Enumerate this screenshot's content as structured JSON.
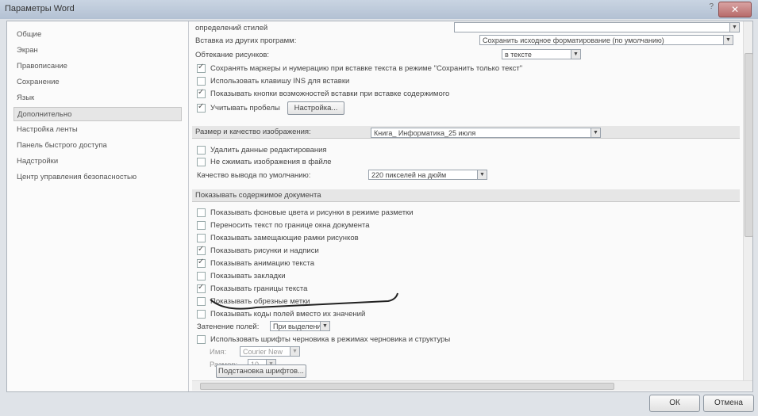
{
  "window": {
    "title": "Параметры Word",
    "close": "✕",
    "help": "? "
  },
  "nav": [
    "Общие",
    "Экран",
    "Правописание",
    "Сохранение",
    "Язык",
    "Дополнительно",
    "Настройка ленты",
    "Панель быстрого доступа",
    "Надстройки",
    "Центр управления безопасностью"
  ],
  "nav_active_index": 5,
  "content": {
    "r0": "определений стилей",
    "r1_label": "Вставка из других программ:",
    "r1_select": "Сохранить исходное форматирование (по умолчанию)",
    "r2_label": "Обтекание рисунков:",
    "r2_select": "в тексте",
    "c1": "Сохранять маркеры и нумерацию при вставке текста в режиме \"Сохранить только текст\"",
    "c2": "Использовать клавишу INS для вставки",
    "c3": "Показывать кнопки возможностей вставки при вставке содержимого",
    "c4": "Учитывать пробелы",
    "c4_btn": "Настройка...",
    "sec_image": "Размер и качество изображения:",
    "sec_image_select": "Книга_ Информатика_25 июля",
    "i1": "Удалить данные редактирования",
    "i2": "Не сжимать изображения в файле",
    "i3_label": "Качество вывода по умолчанию:",
    "i3_select": "220 пикселей на дюйм",
    "sec_show": "Показывать содержимое документа",
    "s1": "Показывать фоновые цвета и рисунки в режиме разметки",
    "s2": "Переносить текст по границе окна документа",
    "s3": "Показывать замещающие рамки рисунков",
    "s4": "Показывать рисунки и надписи",
    "s5": "Показывать анимацию текста",
    "s6": "Показывать закладки",
    "s7": "Показывать границы текста",
    "s8": "Показывать обрезные метки",
    "s9": "Показывать коды полей вместо их значений",
    "f_label": "Затенение полей:",
    "f_select": "При выделении",
    "d1": "Использовать шрифты черновика в режимах черновика и структуры",
    "d2_label": "Имя:",
    "d2_select": "Courier New",
    "d3_label": "Размер:",
    "d3_select": "10",
    "fonts_btn": "Подстановка шрифтов..."
  },
  "checked": {
    "c1": true,
    "c2": false,
    "c3": true,
    "c4": true,
    "i1": false,
    "i2": false,
    "s1": false,
    "s2": false,
    "s3": false,
    "s4": true,
    "s5": true,
    "s6": false,
    "s7": true,
    "s8": false,
    "s9": false,
    "d1": false
  },
  "footer": {
    "ok": "ОК",
    "cancel": "Отмена"
  }
}
